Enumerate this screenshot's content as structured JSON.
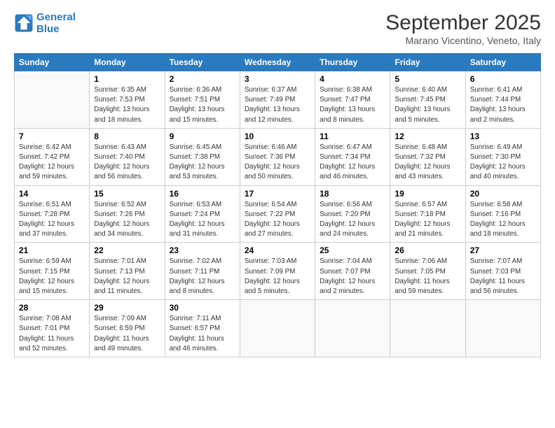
{
  "header": {
    "logo_line1": "General",
    "logo_line2": "Blue",
    "main_title": "September 2025",
    "subtitle": "Marano Vicentino, Veneto, Italy"
  },
  "days_of_week": [
    "Sunday",
    "Monday",
    "Tuesday",
    "Wednesday",
    "Thursday",
    "Friday",
    "Saturday"
  ],
  "weeks": [
    [
      {
        "day": "",
        "info": ""
      },
      {
        "day": "1",
        "info": "Sunrise: 6:35 AM\nSunset: 7:53 PM\nDaylight: 13 hours\nand 18 minutes."
      },
      {
        "day": "2",
        "info": "Sunrise: 6:36 AM\nSunset: 7:51 PM\nDaylight: 13 hours\nand 15 minutes."
      },
      {
        "day": "3",
        "info": "Sunrise: 6:37 AM\nSunset: 7:49 PM\nDaylight: 13 hours\nand 12 minutes."
      },
      {
        "day": "4",
        "info": "Sunrise: 6:38 AM\nSunset: 7:47 PM\nDaylight: 13 hours\nand 8 minutes."
      },
      {
        "day": "5",
        "info": "Sunrise: 6:40 AM\nSunset: 7:45 PM\nDaylight: 13 hours\nand 5 minutes."
      },
      {
        "day": "6",
        "info": "Sunrise: 6:41 AM\nSunset: 7:44 PM\nDaylight: 13 hours\nand 2 minutes."
      }
    ],
    [
      {
        "day": "7",
        "info": "Sunrise: 6:42 AM\nSunset: 7:42 PM\nDaylight: 12 hours\nand 59 minutes."
      },
      {
        "day": "8",
        "info": "Sunrise: 6:43 AM\nSunset: 7:40 PM\nDaylight: 12 hours\nand 56 minutes."
      },
      {
        "day": "9",
        "info": "Sunrise: 6:45 AM\nSunset: 7:38 PM\nDaylight: 12 hours\nand 53 minutes."
      },
      {
        "day": "10",
        "info": "Sunrise: 6:46 AM\nSunset: 7:36 PM\nDaylight: 12 hours\nand 50 minutes."
      },
      {
        "day": "11",
        "info": "Sunrise: 6:47 AM\nSunset: 7:34 PM\nDaylight: 12 hours\nand 46 minutes."
      },
      {
        "day": "12",
        "info": "Sunrise: 6:48 AM\nSunset: 7:32 PM\nDaylight: 12 hours\nand 43 minutes."
      },
      {
        "day": "13",
        "info": "Sunrise: 6:49 AM\nSunset: 7:30 PM\nDaylight: 12 hours\nand 40 minutes."
      }
    ],
    [
      {
        "day": "14",
        "info": "Sunrise: 6:51 AM\nSunset: 7:28 PM\nDaylight: 12 hours\nand 37 minutes."
      },
      {
        "day": "15",
        "info": "Sunrise: 6:52 AM\nSunset: 7:26 PM\nDaylight: 12 hours\nand 34 minutes."
      },
      {
        "day": "16",
        "info": "Sunrise: 6:53 AM\nSunset: 7:24 PM\nDaylight: 12 hours\nand 31 minutes."
      },
      {
        "day": "17",
        "info": "Sunrise: 6:54 AM\nSunset: 7:22 PM\nDaylight: 12 hours\nand 27 minutes."
      },
      {
        "day": "18",
        "info": "Sunrise: 6:56 AM\nSunset: 7:20 PM\nDaylight: 12 hours\nand 24 minutes."
      },
      {
        "day": "19",
        "info": "Sunrise: 6:57 AM\nSunset: 7:18 PM\nDaylight: 12 hours\nand 21 minutes."
      },
      {
        "day": "20",
        "info": "Sunrise: 6:58 AM\nSunset: 7:16 PM\nDaylight: 12 hours\nand 18 minutes."
      }
    ],
    [
      {
        "day": "21",
        "info": "Sunrise: 6:59 AM\nSunset: 7:15 PM\nDaylight: 12 hours\nand 15 minutes."
      },
      {
        "day": "22",
        "info": "Sunrise: 7:01 AM\nSunset: 7:13 PM\nDaylight: 12 hours\nand 11 minutes."
      },
      {
        "day": "23",
        "info": "Sunrise: 7:02 AM\nSunset: 7:11 PM\nDaylight: 12 hours\nand 8 minutes."
      },
      {
        "day": "24",
        "info": "Sunrise: 7:03 AM\nSunset: 7:09 PM\nDaylight: 12 hours\nand 5 minutes."
      },
      {
        "day": "25",
        "info": "Sunrise: 7:04 AM\nSunset: 7:07 PM\nDaylight: 12 hours\nand 2 minutes."
      },
      {
        "day": "26",
        "info": "Sunrise: 7:06 AM\nSunset: 7:05 PM\nDaylight: 11 hours\nand 59 minutes."
      },
      {
        "day": "27",
        "info": "Sunrise: 7:07 AM\nSunset: 7:03 PM\nDaylight: 11 hours\nand 56 minutes."
      }
    ],
    [
      {
        "day": "28",
        "info": "Sunrise: 7:08 AM\nSunset: 7:01 PM\nDaylight: 11 hours\nand 52 minutes."
      },
      {
        "day": "29",
        "info": "Sunrise: 7:09 AM\nSunset: 6:59 PM\nDaylight: 11 hours\nand 49 minutes."
      },
      {
        "day": "30",
        "info": "Sunrise: 7:11 AM\nSunset: 6:57 PM\nDaylight: 11 hours\nand 46 minutes."
      },
      {
        "day": "",
        "info": ""
      },
      {
        "day": "",
        "info": ""
      },
      {
        "day": "",
        "info": ""
      },
      {
        "day": "",
        "info": ""
      }
    ]
  ]
}
